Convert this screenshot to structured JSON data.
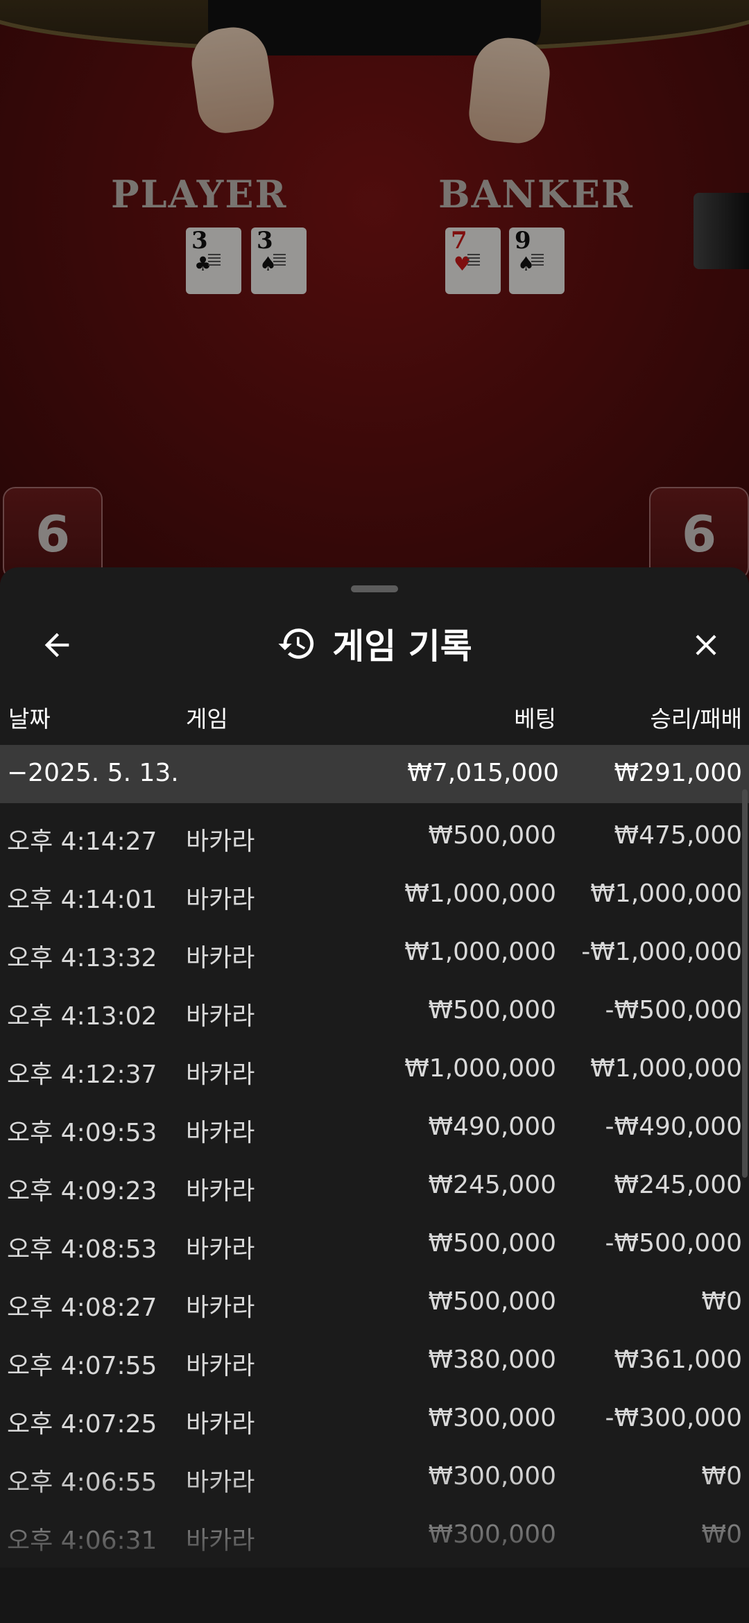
{
  "table": {
    "player_label": "PLAYER",
    "banker_label": "BANKER",
    "player_cards": [
      {
        "rank": "3",
        "suit": "♣",
        "color": "#111111"
      },
      {
        "rank": "3",
        "suit": "♠",
        "color": "#111111"
      }
    ],
    "banker_cards": [
      {
        "rank": "7",
        "suit": "♥",
        "color": "#c41818"
      },
      {
        "rank": "9",
        "suit": "♠",
        "color": "#111111"
      }
    ],
    "player_score": "6",
    "banker_score": "6"
  },
  "sheet": {
    "title": "게임 기록",
    "title_icon": "history-icon",
    "back_icon": "arrow-left-icon",
    "close_icon": "close-icon",
    "columns": {
      "date": "날짜",
      "game": "게임",
      "bet": "베팅",
      "winloss": "승리/패배"
    },
    "summary": {
      "date": "−2025. 5. 13.",
      "bet": "₩7,015,000",
      "winloss": "₩291,000"
    },
    "rows": [
      {
        "time": "오후 4:14:27",
        "game": "바카라",
        "bet": "₩500,000",
        "winloss": "₩475,000"
      },
      {
        "time": "오후 4:14:01",
        "game": "바카라",
        "bet": "₩1,000,000",
        "winloss": "₩1,000,000"
      },
      {
        "time": "오후 4:13:32",
        "game": "바카라",
        "bet": "₩1,000,000",
        "winloss": "-₩1,000,000"
      },
      {
        "time": "오후 4:13:02",
        "game": "바카라",
        "bet": "₩500,000",
        "winloss": "-₩500,000"
      },
      {
        "time": "오후 4:12:37",
        "game": "바카라",
        "bet": "₩1,000,000",
        "winloss": "₩1,000,000"
      },
      {
        "time": "오후 4:09:53",
        "game": "바카라",
        "bet": "₩490,000",
        "winloss": "-₩490,000"
      },
      {
        "time": "오후 4:09:23",
        "game": "바카라",
        "bet": "₩245,000",
        "winloss": "₩245,000"
      },
      {
        "time": "오후 4:08:53",
        "game": "바카라",
        "bet": "₩500,000",
        "winloss": "-₩500,000"
      },
      {
        "time": "오후 4:08:27",
        "game": "바카라",
        "bet": "₩500,000",
        "winloss": "₩0"
      },
      {
        "time": "오후 4:07:55",
        "game": "바카라",
        "bet": "₩380,000",
        "winloss": "₩361,000"
      },
      {
        "time": "오후 4:07:25",
        "game": "바카라",
        "bet": "₩300,000",
        "winloss": "-₩300,000"
      },
      {
        "time": "오후 4:06:55",
        "game": "바카라",
        "bet": "₩300,000",
        "winloss": "₩0"
      },
      {
        "time": "오후 4:06:31",
        "game": "바카라",
        "bet": "₩300,000",
        "winloss": "₩0"
      }
    ]
  },
  "colors": {
    "sheet_bg": "#1b1b1b",
    "summary_bg": "#3a3a3a",
    "table_felt": "#6b1212"
  }
}
